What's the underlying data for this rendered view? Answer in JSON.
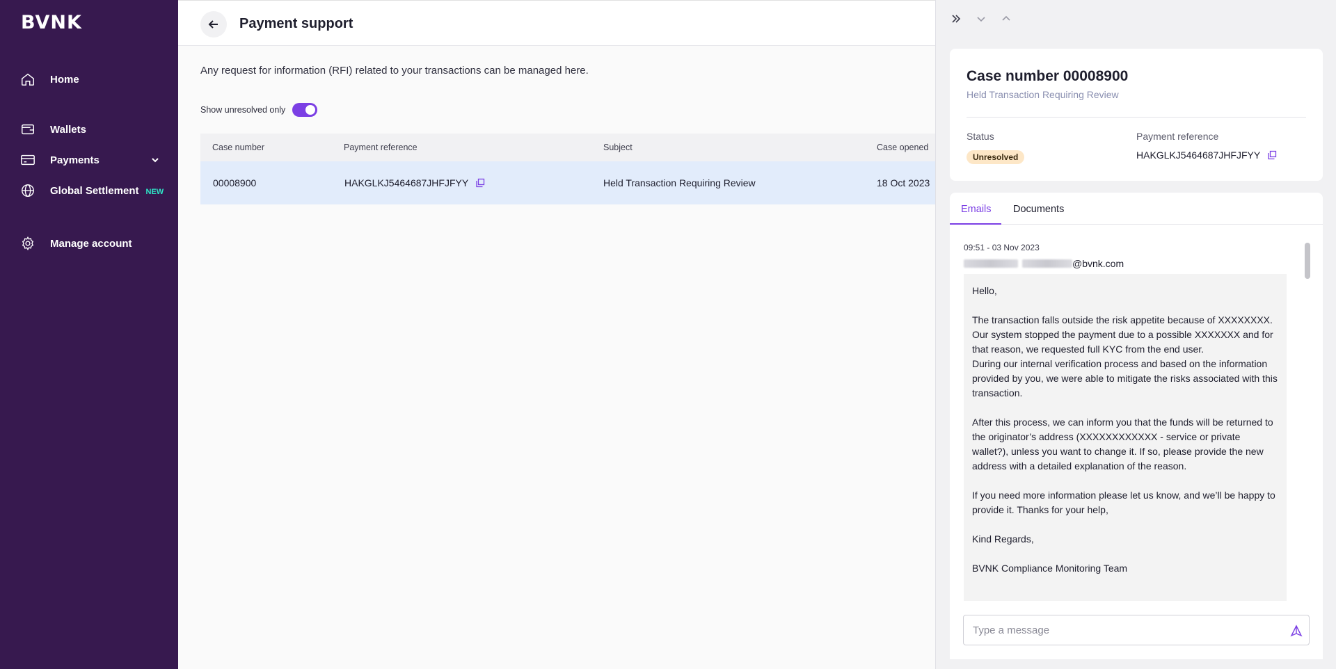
{
  "brand": {
    "logo": "BVNK",
    "accent": "#7b3fe4",
    "sidebar_bg": "#37194f"
  },
  "sidebar": {
    "items": [
      {
        "label": "Home",
        "icon": "home-icon"
      },
      {
        "label": "Wallets",
        "icon": "wallet-icon"
      },
      {
        "label": "Payments",
        "icon": "card-icon",
        "expandable": true
      },
      {
        "label": "Global Settlement",
        "icon": "globe-icon",
        "badge": "NEW"
      },
      {
        "label": "Manage account",
        "icon": "gear-icon"
      }
    ]
  },
  "header": {
    "title": "Payment support"
  },
  "main": {
    "intro": "Any request for information (RFI) related to your transactions can be managed here.",
    "toggle_label": "Show unresolved only",
    "toggle_on": true,
    "table": {
      "columns": [
        "Case number",
        "Payment reference",
        "Subject",
        "Case opened"
      ],
      "rows": [
        {
          "case_number": "00008900",
          "payment_reference": "HAKGLKJ5464687JHFJFYY",
          "subject": "Held Transaction Requiring Review",
          "case_opened": "18 Oct 2023"
        }
      ]
    }
  },
  "panel": {
    "case_title": "Case number 00008900",
    "case_subtitle": "Held Transaction Requiring Review",
    "status_label": "Status",
    "status_value": "Unresolved",
    "payref_label": "Payment reference",
    "payref_value": "HAKGLKJ5464687JHFJFYY",
    "tabs": [
      "Emails",
      "Documents"
    ],
    "email": {
      "time": "09:51 - 03 Nov 2023",
      "from_domain": "@bvnk.com",
      "greeting": "Hello,",
      "para1": "The transaction falls outside the risk appetite because of XXXXXXXX. Our system stopped the payment due to a possible XXXXXXX and for that reason, we requested full KYC from the end user.",
      "para2": "During our internal verification process and based on the information provided by you, we were able to mitigate the risks associated with this transaction.",
      "para3": "After this process, we can inform you that the funds will be returned to the originator’s address (XXXXXXXXXXXX - service or private wallet?), unless you want to change it. If so, please provide the new address with a detailed explanation of the reason.",
      "para4": "If you need more information please let us know, and we’ll be happy to provide it. Thanks for your help,",
      "closing": "Kind Regards,",
      "signature": "BVNK Compliance Monitoring Team"
    },
    "message_placeholder": "Type a message"
  }
}
